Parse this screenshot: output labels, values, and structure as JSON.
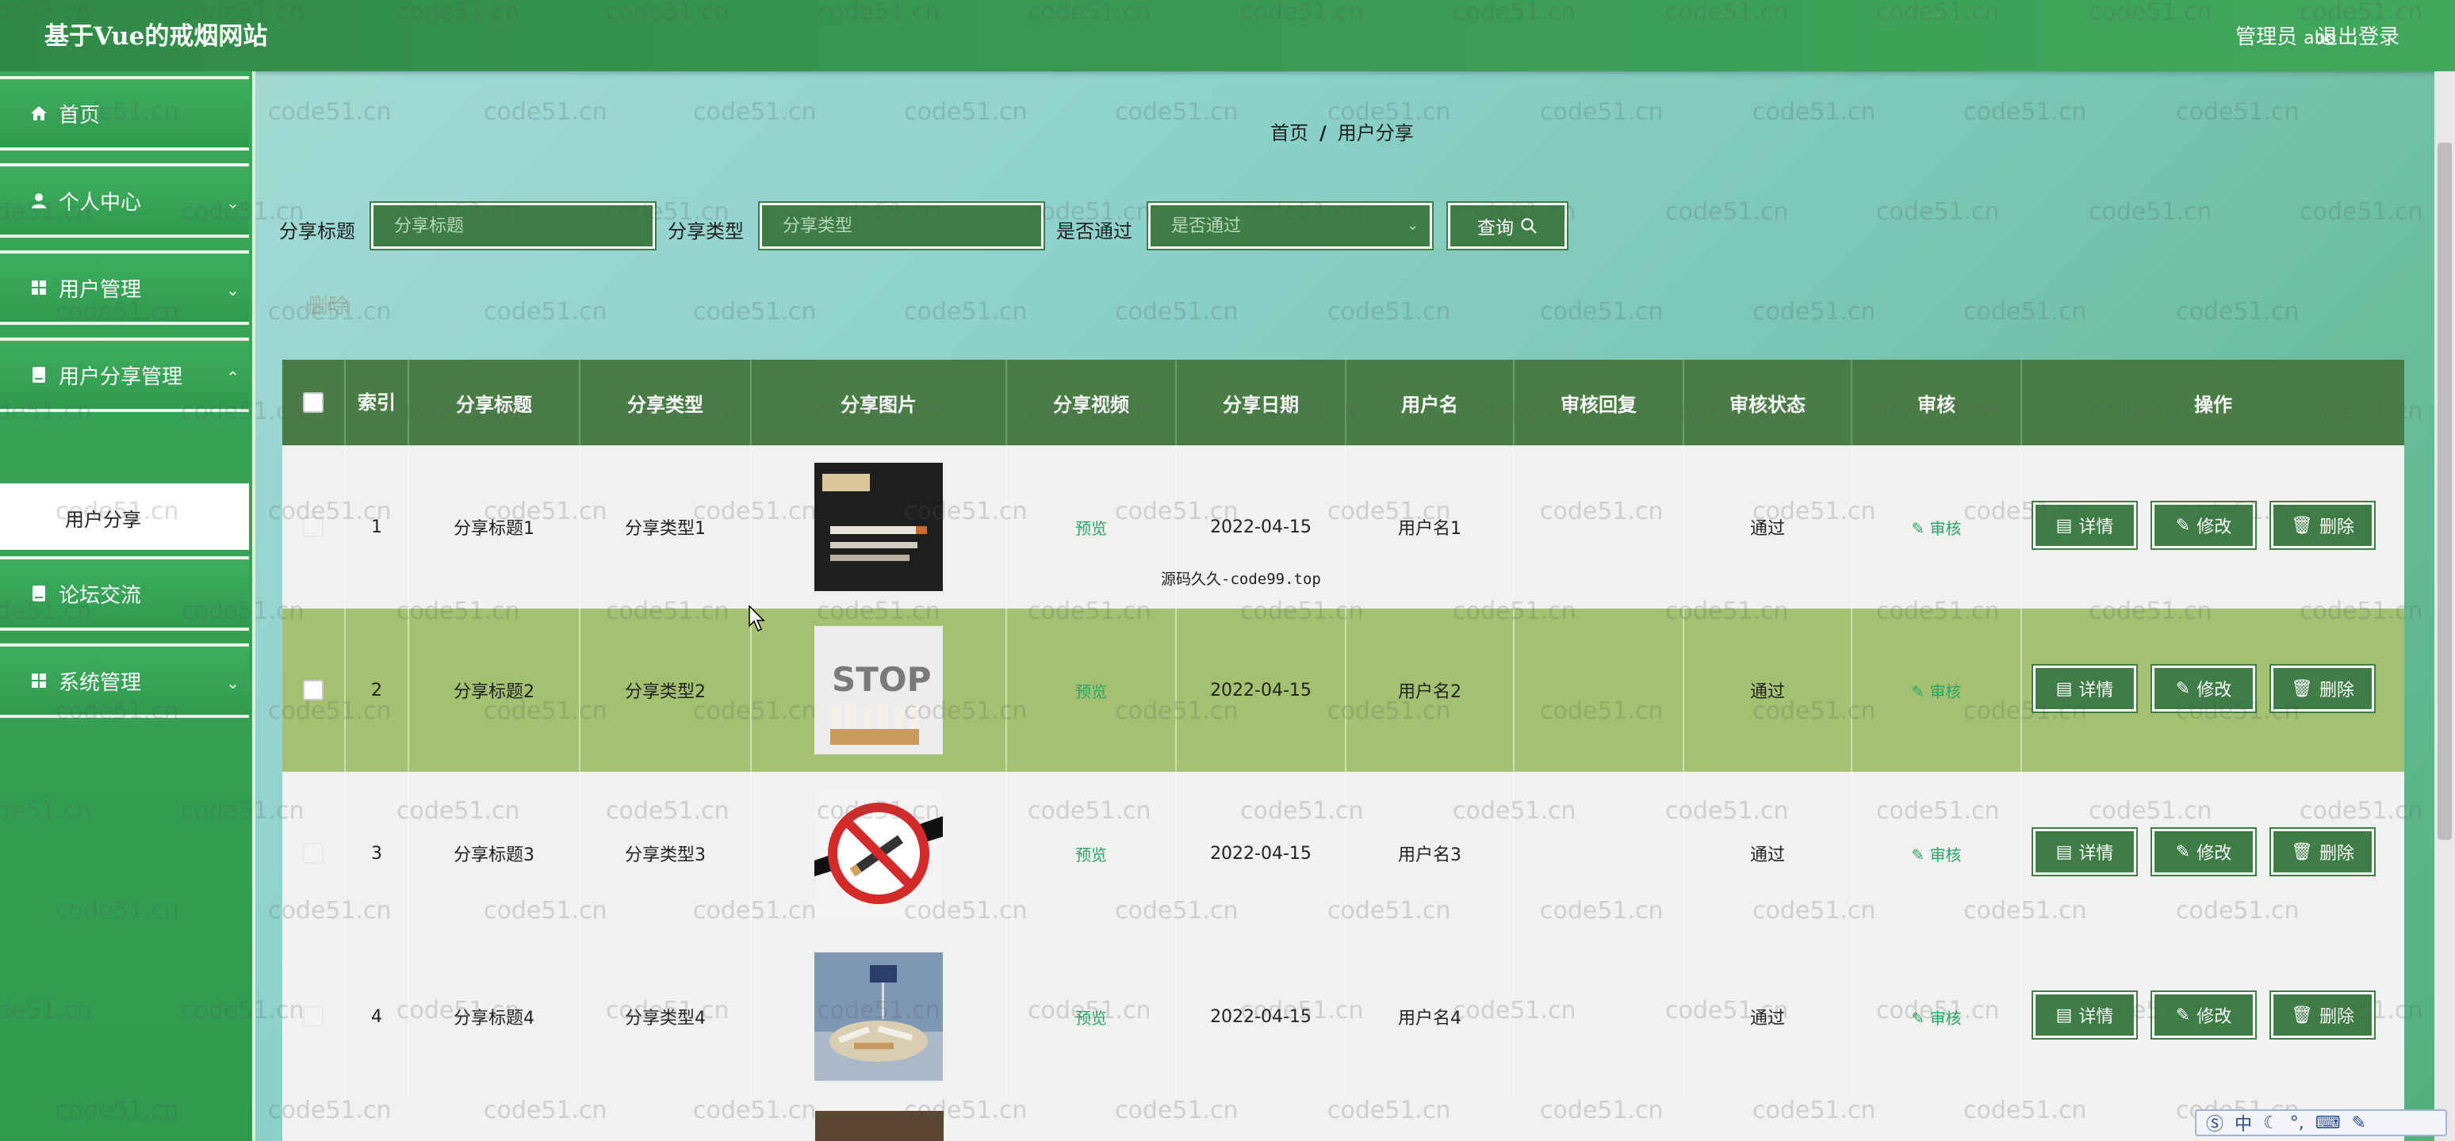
{
  "app": {
    "title": "基于Vue的戒烟网站",
    "admin_label": "管理员",
    "admin_name": "abo",
    "logout": "退出登录"
  },
  "sidebar": {
    "items": [
      {
        "label": "首页",
        "icon": "home-icon"
      },
      {
        "label": "个人中心",
        "icon": "user-icon"
      },
      {
        "label": "用户管理",
        "icon": "grid-icon"
      },
      {
        "label": "用户分享管理",
        "icon": "book-icon"
      },
      {
        "label": "论坛交流",
        "icon": "book-icon"
      },
      {
        "label": "系统管理",
        "icon": "grid-icon"
      }
    ],
    "active_sub": "用户分享"
  },
  "breadcrumb": {
    "home": "首页",
    "sep": "/",
    "current": "用户分享"
  },
  "search": {
    "title_label": "分享标题",
    "title_placeholder": "分享标题",
    "type_label": "分享类型",
    "type_placeholder": "分享类型",
    "pass_label": "是否通过",
    "pass_placeholder": "是否通过",
    "query_label": "查询"
  },
  "bulk_delete": "删除",
  "table": {
    "headers": [
      "索引",
      "分享标题",
      "分享类型",
      "分享图片",
      "分享视频",
      "分享日期",
      "用户名",
      "审核回复",
      "审核状态",
      "审核",
      "操作"
    ],
    "rows": [
      {
        "index": "1",
        "title": "分享标题1",
        "type": "分享类型1",
        "video": "预览",
        "date": "2022-04-15",
        "user": "用户名1",
        "reply": "",
        "status": "通过",
        "audit": "审核"
      },
      {
        "index": "2",
        "title": "分享标题2",
        "type": "分享类型2",
        "video": "预览",
        "date": "2022-04-15",
        "user": "用户名2",
        "reply": "",
        "status": "通过",
        "audit": "审核"
      },
      {
        "index": "3",
        "title": "分享标题3",
        "type": "分享类型3",
        "video": "预览",
        "date": "2022-04-15",
        "user": "用户名3",
        "reply": "",
        "status": "通过",
        "audit": "审核"
      },
      {
        "index": "4",
        "title": "分享标题4",
        "type": "分享类型4",
        "video": "预览",
        "date": "2022-04-15",
        "user": "用户名4",
        "reply": "",
        "status": "通过",
        "audit": "审核"
      }
    ],
    "actions": {
      "detail": "详情",
      "edit": "修改",
      "delete": "删除"
    }
  },
  "overlay_note": "源码久久-code99.top",
  "watermark": "code51.cn",
  "ime": {
    "mode": "中"
  },
  "colors": {
    "header_green": "#3a9a55",
    "table_head": "#4a7d46",
    "row_highlight": "#a4c071",
    "button": "#3e7d45",
    "link": "#2aa66a"
  }
}
